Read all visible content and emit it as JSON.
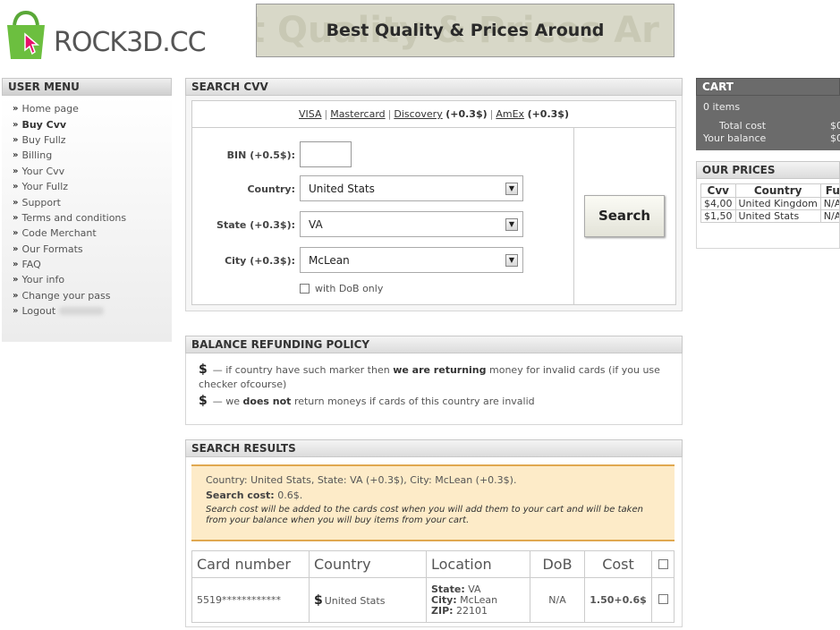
{
  "header": {
    "logo_text": "ROCK3D.CC",
    "banner_text": "Best Quality & Prices Around",
    "banner_bg_text": "t Quality & Prices Ar"
  },
  "user_menu": {
    "title": "USER MENU",
    "items": [
      {
        "label": "Home page"
      },
      {
        "label": "Buy Cvv"
      },
      {
        "label": "Buy Fullz"
      },
      {
        "label": "Billing"
      },
      {
        "label": "Your Cvv"
      },
      {
        "label": "Your Fullz"
      },
      {
        "label": "Support"
      },
      {
        "label": "Terms and conditions"
      },
      {
        "label": "Code Merchant"
      },
      {
        "label": "Our Formats"
      },
      {
        "label": "FAQ"
      },
      {
        "label": "Your info"
      },
      {
        "label": "Change your pass"
      },
      {
        "label": "Logout"
      }
    ]
  },
  "search_cvv": {
    "title": "SEARCH CVV",
    "card_types": {
      "visa": "VISA",
      "mastercard": "Mastercard",
      "discovery": "Discovery",
      "discovery_fee": "(+0.3$)",
      "amex": "AmEx",
      "amex_fee": "(+0.3$)"
    },
    "bin_label": "BIN",
    "bin_fee": "(+0.5$):",
    "bin_value": "",
    "country_label": "Country:",
    "country_value": "United Stats",
    "state_label": "State",
    "state_fee": "(+0.3$):",
    "state_value": "VA",
    "city_label": "City",
    "city_fee": "(+0.3$):",
    "city_value": "McLean",
    "dob_label": "with DoB only",
    "search_button": "Search"
  },
  "refund_policy": {
    "title": "BALANCE REFUNDING POLICY",
    "line1_pre": "— if country have such marker then",
    "line1_bold": "we are returning",
    "line1_post": "money for invalid cards (if you use checker ofcourse)",
    "line2_pre": "— we",
    "line2_bold": "does not",
    "line2_post": "return moneys if cards of this country are invalid"
  },
  "search_results": {
    "title": "SEARCH RESULTS",
    "criteria": "Country: United Stats, State: VA (+0.3$), City: McLean (+0.3$).",
    "cost_label": "Search cost:",
    "cost_value": "0.6$.",
    "note": "Search cost will be added to the cards cost when you will add them to your cart and will be taken from your balance when you will buy items from your cart.",
    "columns": [
      "Card number",
      "Country",
      "Location",
      "DoB",
      "Cost"
    ],
    "rows": [
      {
        "card_number": "5519************",
        "country": "United Stats",
        "state_label": "State:",
        "state": "VA",
        "city_label": "City:",
        "city": "McLean",
        "zip_label": "ZIP:",
        "zip": "22101",
        "dob": "N/A",
        "cost": "1.50+0.6$"
      }
    ]
  },
  "cart": {
    "title": "CART",
    "items_text": "0 items",
    "total_cost_label": "Total cost",
    "total_cost_value": "$0",
    "balance_label": "Your balance",
    "balance_value": "$0"
  },
  "our_prices": {
    "title": "OUR PRICES",
    "columns": [
      "Cvv",
      "Country",
      "Fu"
    ],
    "rows": [
      {
        "cvv": "$4,00",
        "country": "United Kingdom",
        "fullz": "N/A"
      },
      {
        "cvv": "$1,50",
        "country": "United Stats",
        "fullz": "N/A"
      }
    ]
  }
}
